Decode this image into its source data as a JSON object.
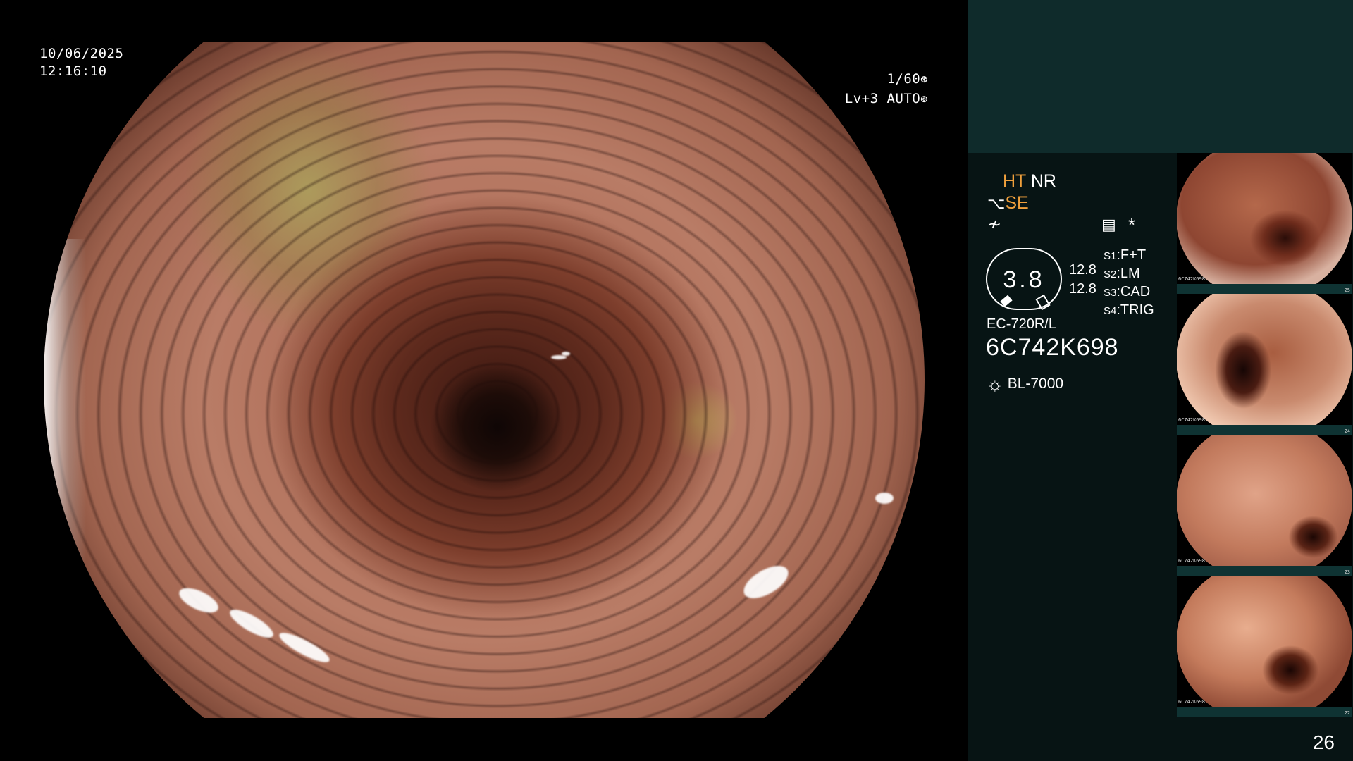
{
  "overlay": {
    "date": "10/06/2025",
    "time": "12:16:10",
    "shutter": "1/60",
    "level": "Lv+3",
    "mode": "AUTO"
  },
  "panel": {
    "mode_ht": "HT",
    "mode_nr": "NR",
    "mode_se": "SE",
    "scope_value": "3.8",
    "readings": [
      "12.8",
      "12.8"
    ],
    "settings": [
      {
        "key": "S1",
        "value": "F+T"
      },
      {
        "key": "S2",
        "value": "LM"
      },
      {
        "key": "S3",
        "value": "CAD"
      },
      {
        "key": "S4",
        "value": "TRIG"
      }
    ],
    "scope_model": "EC-720R/L",
    "scope_serial": "6C742K698",
    "light_source": "BL-7000",
    "image_count": "26"
  },
  "thumbnails": [
    {
      "label": "6C742K698",
      "index": "25"
    },
    {
      "label": "6C742K698",
      "index": "24"
    },
    {
      "label": "6C742K698",
      "index": "23"
    },
    {
      "label": "6C742K698",
      "index": "22"
    }
  ],
  "colors": {
    "panel_bg": "#071414",
    "panel_top": "#0f2b2b",
    "accent": "#f0a03c"
  }
}
